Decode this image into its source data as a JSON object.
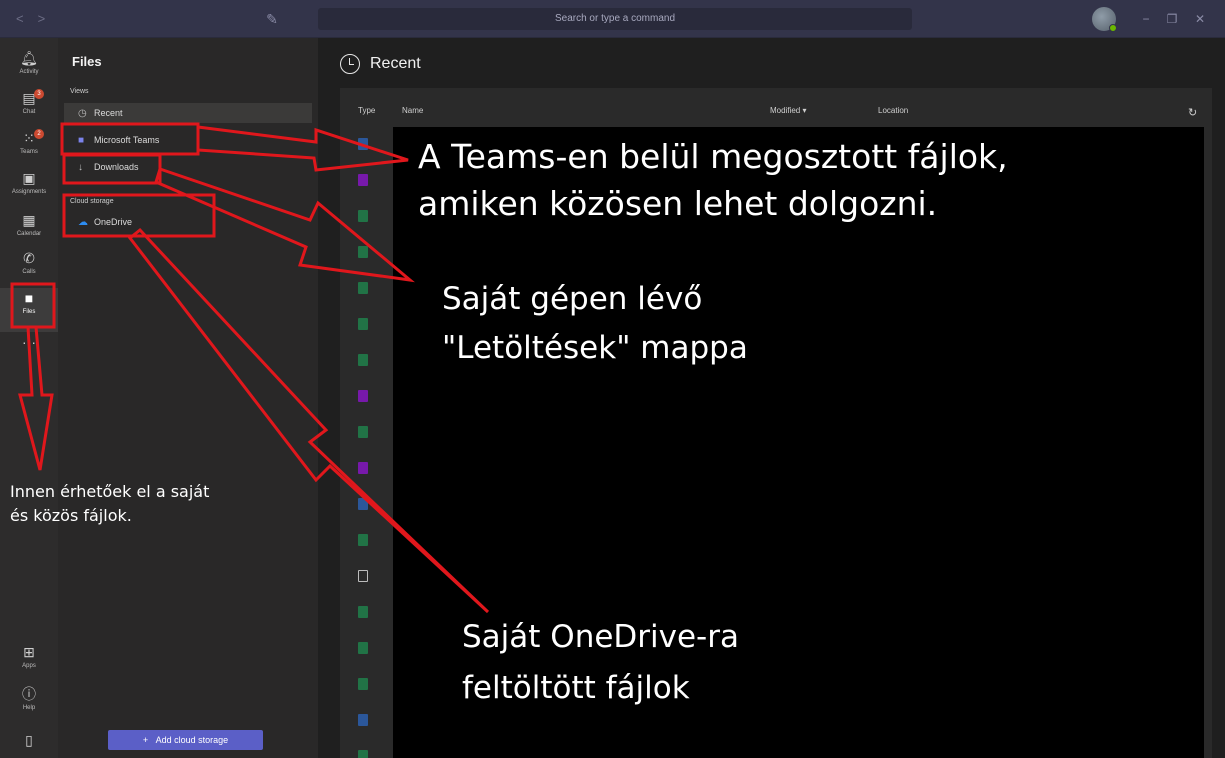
{
  "titlebar": {
    "search_placeholder": "Search or type a command",
    "back_icon": "chevron-left-icon",
    "forward_icon": "chevron-right-icon",
    "compose_icon": "compose-icon",
    "minimize": "−",
    "maximize": "❐",
    "close": "✕"
  },
  "rail": {
    "items": [
      {
        "label": "Activity",
        "icon": "bell-icon"
      },
      {
        "label": "Chat",
        "icon": "chat-icon",
        "badge": "3"
      },
      {
        "label": "Teams",
        "icon": "teams-icon",
        "badge": "2"
      },
      {
        "label": "Assignments",
        "icon": "assignments-icon"
      },
      {
        "label": "Calendar",
        "icon": "calendar-icon"
      },
      {
        "label": "Calls",
        "icon": "phone-icon"
      },
      {
        "label": "Files",
        "icon": "file-icon"
      },
      {
        "label": "Apps",
        "icon": "apps-icon"
      },
      {
        "label": "Help",
        "icon": "help-icon"
      }
    ],
    "more": "···"
  },
  "files": {
    "title": "Files",
    "views_label": "Views",
    "recent": "Recent",
    "microsoft_teams": "Microsoft Teams",
    "downloads": "Downloads",
    "cloud_label": "Cloud storage",
    "onedrive": "OneDrive",
    "add_cloud": "Add cloud storage"
  },
  "main": {
    "title": "Recent",
    "columns": {
      "type": "Type",
      "name": "Name",
      "modified": "Modified",
      "location": "Location"
    },
    "type_icons": [
      "word",
      "onenote",
      "excel",
      "excel",
      "excel",
      "excel",
      "excel",
      "onenote",
      "excel",
      "onenote",
      "word",
      "excel",
      "file",
      "excel",
      "excel",
      "excel",
      "word",
      "excel"
    ]
  },
  "annotations": {
    "teams_line1": "A Teams-en belül megosztott fájlok,",
    "teams_line2": "amiken közösen lehet dolgozni.",
    "downloads_line1": "Saját gépen lévő",
    "downloads_line2": "\"Letöltések\" mappa",
    "onedrive_line1": "Saját OneDrive-ra",
    "onedrive_line2": "feltöltött fájlok",
    "files_line1": "Innen érhetőek el a saját",
    "files_line2": "és közös fájlok."
  },
  "colors": {
    "accent": "#5b5fc7",
    "annotation_red": "#e0171c",
    "word": "#2b579a",
    "excel": "#217346",
    "onenote": "#7719aa"
  }
}
